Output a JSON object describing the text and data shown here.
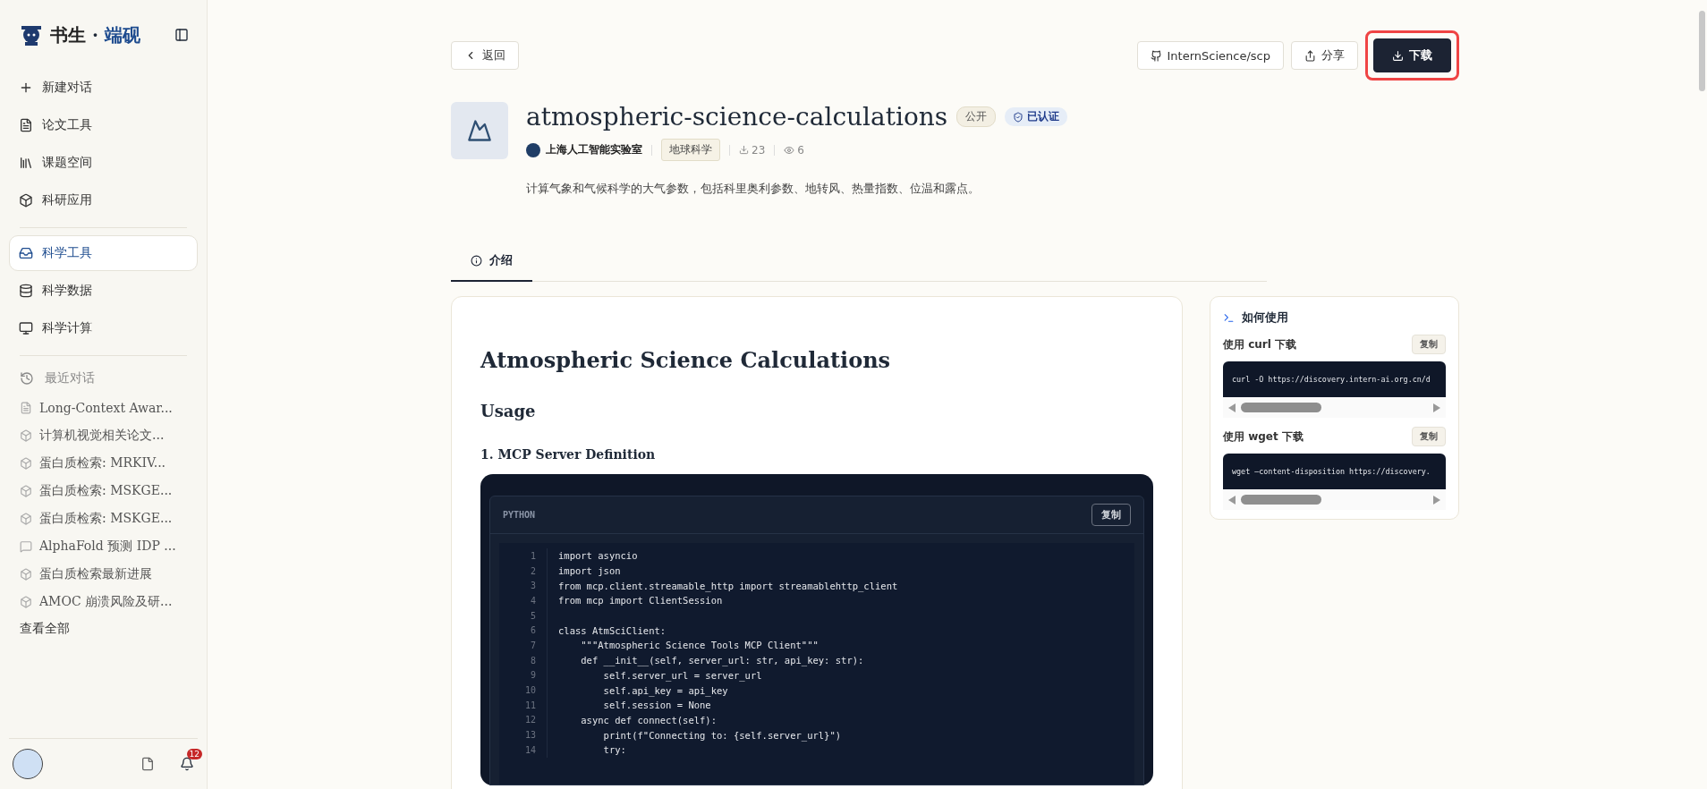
{
  "sidebar": {
    "brand": {
      "part1": "书生",
      "dot": "·",
      "part2": "端砚"
    },
    "nav": [
      {
        "label": "新建对话",
        "selected": false
      },
      {
        "label": "论文工具",
        "selected": false
      },
      {
        "label": "课题空间",
        "selected": false
      },
      {
        "label": "科研应用",
        "selected": false
      }
    ],
    "science": [
      {
        "label": "科学工具",
        "selected": true
      },
      {
        "label": "科学数据",
        "selected": false
      },
      {
        "label": "科学计算",
        "selected": false
      }
    ],
    "recent_title": "最近对话",
    "recent": [
      {
        "label": "Long-Context Awar...",
        "kind": "doc"
      },
      {
        "label": "计算机视觉相关论文...",
        "kind": "cube"
      },
      {
        "label": "蛋白质检索: MRKIV...",
        "kind": "cube"
      },
      {
        "label": "蛋白质检索: MSKGE...",
        "kind": "cube"
      },
      {
        "label": "蛋白质检索: MSKGE...",
        "kind": "cube"
      },
      {
        "label": "AlphaFold 预测 IDP ...",
        "kind": "chat"
      },
      {
        "label": "蛋白质检索最新进展",
        "kind": "cube"
      },
      {
        "label": "AMOC 崩溃风险及研...",
        "kind": "cube"
      }
    ],
    "view_all": "查看全部",
    "notifications": "12"
  },
  "header": {
    "back": "返回",
    "repo": "InternScience/scp",
    "share": "分享",
    "download": {
      "label": "下载",
      "highlighted": true
    }
  },
  "tool": {
    "name": "atmospheric-science-calculations",
    "visibility": "公开",
    "verified": "已认证",
    "org": "上海人工智能实验室",
    "category": "地球科学",
    "downloads": "23",
    "views": "6",
    "description": "计算气象和气候科学的大气参数，包括科里奥利参数、地转风、热量指数、位温和露点。"
  },
  "tabs": [
    {
      "label": "介绍",
      "selected": true
    }
  ],
  "readme": {
    "title": "Atmospheric Science Calculations",
    "h2": "Usage",
    "h3": "1. MCP Server Definition",
    "code": {
      "language": "PYTHON",
      "copy": "复制",
      "lines": [
        {
          "number": "1",
          "code": "import asyncio"
        },
        {
          "number": "2",
          "code": "import json"
        },
        {
          "number": "3",
          "code": "from mcp.client.streamable_http import streamablehttp_client"
        },
        {
          "number": "4",
          "code": "from mcp import ClientSession"
        },
        {
          "number": "5"
        },
        {
          "number": "6",
          "code": "class AtmSciClient:"
        },
        {
          "number": "7",
          "code": "    \"\"\"Atmospheric Science Tools MCP Client\"\"\""
        },
        {
          "number": "8",
          "code": "    def __init__(self, server_url: str, api_key: str):"
        },
        {
          "number": "9",
          "code": "        self.server_url = server_url"
        },
        {
          "number": "10",
          "code": "        self.api_key = api_key"
        },
        {
          "number": "11",
          "code": "        self.session = None"
        },
        {
          "number": "12",
          "code": "    async def connect(self):"
        },
        {
          "number": "13",
          "code": "        print(f\"Connecting to: {self.server_url}\")"
        },
        {
          "number": "14",
          "code": "        try:"
        }
      ]
    }
  },
  "usage": {
    "title": "如何使用",
    "blocks": [
      {
        "label": "使用 curl 下载",
        "copy": "复制",
        "command": "curl -O https://discovery.intern-ai.org.cn/d"
      },
      {
        "label": "使用 wget 下载",
        "copy": "复制",
        "command": "wget —content-disposition https://discovery."
      }
    ]
  }
}
